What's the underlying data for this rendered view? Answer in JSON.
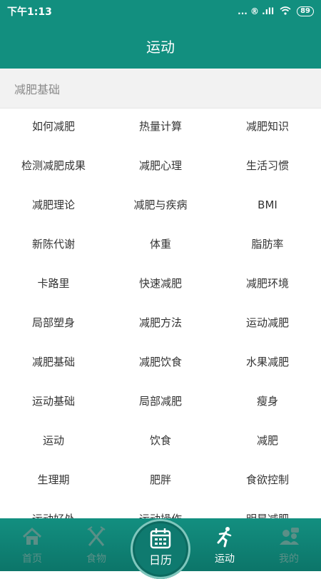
{
  "status": {
    "time": "下午1:13",
    "icons": "... ® .ıll",
    "battery": "89"
  },
  "header": {
    "title": "运动"
  },
  "section": {
    "title": "减肥基础"
  },
  "grid": [
    [
      "如何减肥",
      "热量计算",
      "减肥知识"
    ],
    [
      "检测减肥成果",
      "减肥心理",
      "生活习惯"
    ],
    [
      "减肥理论",
      "减肥与疾病",
      "BMI"
    ],
    [
      "新陈代谢",
      "体重",
      "脂肪率"
    ],
    [
      "卡路里",
      "快速减肥",
      "减肥环境"
    ],
    [
      "局部塑身",
      "减肥方法",
      "运动减肥"
    ],
    [
      "减肥基础",
      "减肥饮食",
      "水果减肥"
    ],
    [
      "运动基础",
      "局部减肥",
      "瘦身"
    ],
    [
      "运动",
      "饮食",
      "减肥"
    ],
    [
      "生理期",
      "肥胖",
      "食欲控制"
    ],
    [
      "运动好处",
      "运动操作",
      "明星减肥"
    ]
  ],
  "tabbar": {
    "home": "首页",
    "food": "食物",
    "calendar": "日历",
    "sport": "运动",
    "me": "我的"
  }
}
